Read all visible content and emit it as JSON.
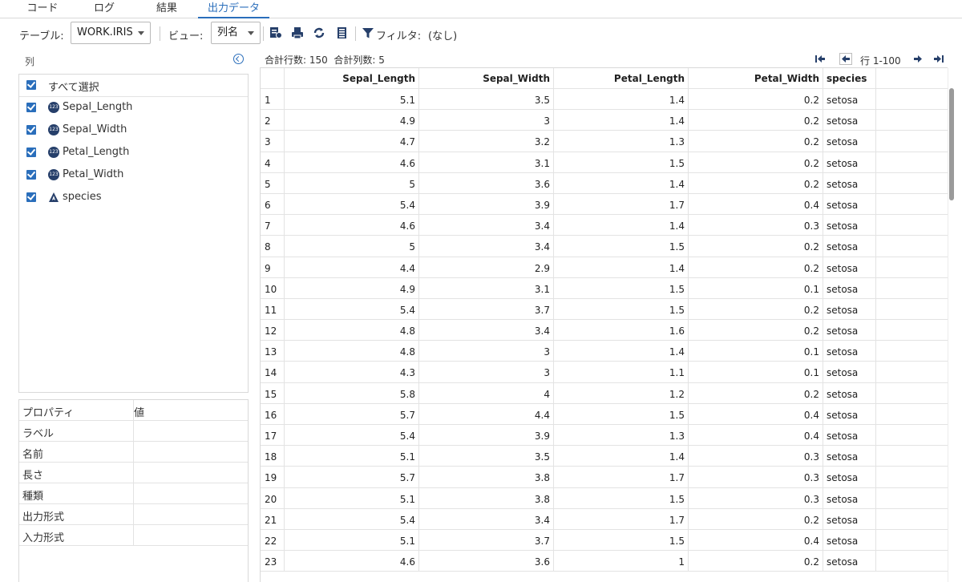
{
  "tabs": [
    {
      "label": "コード"
    },
    {
      "label": "ログ"
    },
    {
      "label": "結果"
    },
    {
      "label": "出力データ"
    }
  ],
  "toolbar": {
    "table_label": "テーブル:",
    "table_value": "WORK.IRIS",
    "view_label": "ビュー:",
    "view_value": "列名",
    "filter_label": "フィルタ:",
    "filter_value": "(なし)"
  },
  "columns_panel": {
    "header": "列",
    "select_all": "すべて選択",
    "items": [
      {
        "name": "Sepal_Length",
        "type": "numeric"
      },
      {
        "name": "Sepal_Width",
        "type": "numeric"
      },
      {
        "name": "Petal_Length",
        "type": "numeric"
      },
      {
        "name": "Petal_Width",
        "type": "numeric"
      },
      {
        "name": "species",
        "type": "character"
      }
    ],
    "numeric_icon_text": "123"
  },
  "properties": {
    "header_key": "プロパティ",
    "header_value": "値",
    "rows": [
      "ラベル",
      "名前",
      "長さ",
      "種類",
      "出力形式",
      "入力形式"
    ]
  },
  "summary": {
    "rows_text": "合計行数: 150",
    "cols_text": "合計列数: 5"
  },
  "pager": {
    "range_text": "行 1-100"
  },
  "table": {
    "headers": [
      "",
      "Sepal_Length",
      "Sepal_Width",
      "Petal_Length",
      "Petal_Width",
      "species",
      ""
    ],
    "rows": [
      [
        "1",
        "5.1",
        "3.5",
        "1.4",
        "0.2",
        "setosa"
      ],
      [
        "2",
        "4.9",
        "3",
        "1.4",
        "0.2",
        "setosa"
      ],
      [
        "3",
        "4.7",
        "3.2",
        "1.3",
        "0.2",
        "setosa"
      ],
      [
        "4",
        "4.6",
        "3.1",
        "1.5",
        "0.2",
        "setosa"
      ],
      [
        "5",
        "5",
        "3.6",
        "1.4",
        "0.2",
        "setosa"
      ],
      [
        "6",
        "5.4",
        "3.9",
        "1.7",
        "0.4",
        "setosa"
      ],
      [
        "7",
        "4.6",
        "3.4",
        "1.4",
        "0.3",
        "setosa"
      ],
      [
        "8",
        "5",
        "3.4",
        "1.5",
        "0.2",
        "setosa"
      ],
      [
        "9",
        "4.4",
        "2.9",
        "1.4",
        "0.2",
        "setosa"
      ],
      [
        "10",
        "4.9",
        "3.1",
        "1.5",
        "0.1",
        "setosa"
      ],
      [
        "11",
        "5.4",
        "3.7",
        "1.5",
        "0.2",
        "setosa"
      ],
      [
        "12",
        "4.8",
        "3.4",
        "1.6",
        "0.2",
        "setosa"
      ],
      [
        "13",
        "4.8",
        "3",
        "1.4",
        "0.1",
        "setosa"
      ],
      [
        "14",
        "4.3",
        "3",
        "1.1",
        "0.1",
        "setosa"
      ],
      [
        "15",
        "5.8",
        "4",
        "1.2",
        "0.2",
        "setosa"
      ],
      [
        "16",
        "5.7",
        "4.4",
        "1.5",
        "0.4",
        "setosa"
      ],
      [
        "17",
        "5.4",
        "3.9",
        "1.3",
        "0.4",
        "setosa"
      ],
      [
        "18",
        "5.1",
        "3.5",
        "1.4",
        "0.3",
        "setosa"
      ],
      [
        "19",
        "5.7",
        "3.8",
        "1.7",
        "0.3",
        "setosa"
      ],
      [
        "20",
        "5.1",
        "3.8",
        "1.5",
        "0.3",
        "setosa"
      ],
      [
        "21",
        "5.4",
        "3.4",
        "1.7",
        "0.2",
        "setosa"
      ],
      [
        "22",
        "5.1",
        "3.7",
        "1.5",
        "0.4",
        "setosa"
      ],
      [
        "23",
        "4.6",
        "3.6",
        "1",
        "0.2",
        "setosa"
      ]
    ]
  },
  "colors": {
    "accent": "#2a6ebb",
    "icon_dark": "#263f6a"
  },
  "icons": {
    "table_tools": [
      "table-properties-icon",
      "print-icon",
      "refresh-icon",
      "columns-icon"
    ],
    "filter": "filter-icon",
    "pager": [
      "first-page-icon",
      "previous-page-icon",
      "next-page-icon",
      "last-page-icon"
    ]
  }
}
